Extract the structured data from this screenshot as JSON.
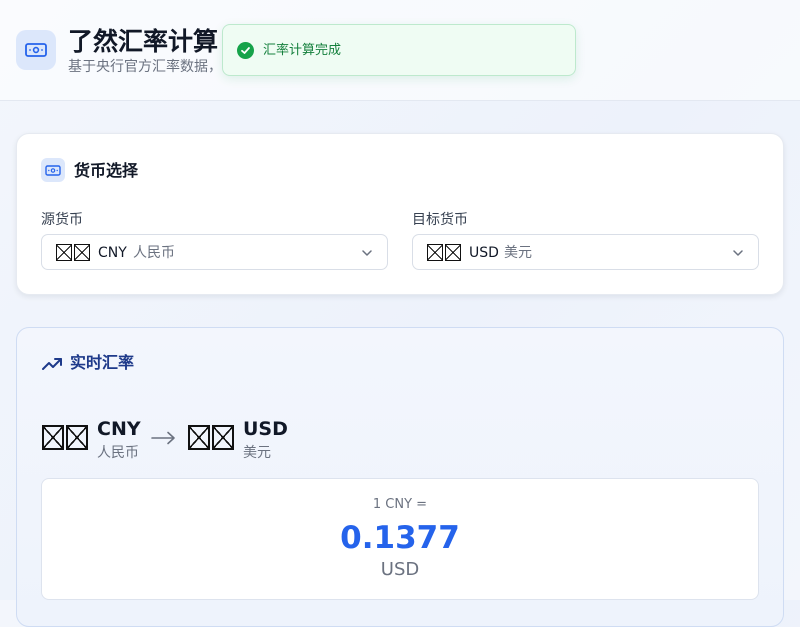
{
  "app": {
    "title": "了然汇率计算小",
    "subtitle": "基于央行官方汇率数据，",
    "logo_icon": "banknote-icon"
  },
  "toast": {
    "message": "汇率计算完成",
    "icon": "check-circle-icon",
    "color": "#16a34a"
  },
  "currency_card": {
    "title": "货币选择",
    "icon": "banknote-icon",
    "source": {
      "label": "源货币",
      "code": "CNY",
      "name": "人民币"
    },
    "target": {
      "label": "目标货币",
      "code": "USD",
      "name": "美元"
    }
  },
  "rate_card": {
    "title": "实时汇率",
    "icon": "trending-up-icon",
    "from": {
      "code": "CNY",
      "name": "人民币"
    },
    "to": {
      "code": "USD",
      "name": "美元"
    },
    "result_prefix": "1 CNY =",
    "result_value": "0.1377",
    "result_unit": "USD",
    "accent_color": "#2563eb"
  }
}
